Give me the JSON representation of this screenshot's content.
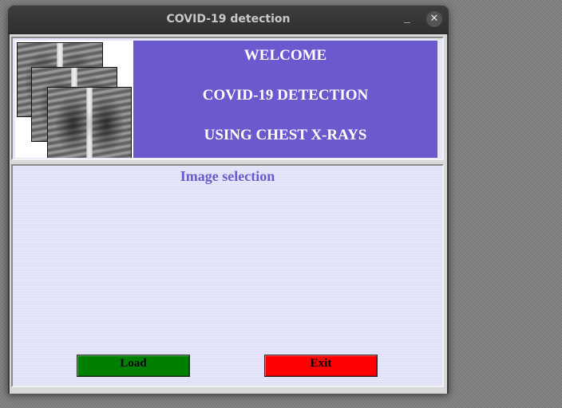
{
  "window": {
    "title": "COVID-19 detection",
    "minimize_icon": "minimize-icon",
    "close_icon": "close-icon",
    "close_glyph": "✕"
  },
  "header": {
    "image": "chest-xray-images",
    "line1": "WELCOME",
    "line2": "COVID-19 DETECTION",
    "line3": "USING CHEST X-RAYS",
    "banner_color": "#6a5acd"
  },
  "selection": {
    "title": "Image selection",
    "background_color": "#e6e6fa",
    "load_label": "Load",
    "exit_label": "Exit",
    "load_color": "#008000",
    "exit_color": "#ff0000"
  }
}
